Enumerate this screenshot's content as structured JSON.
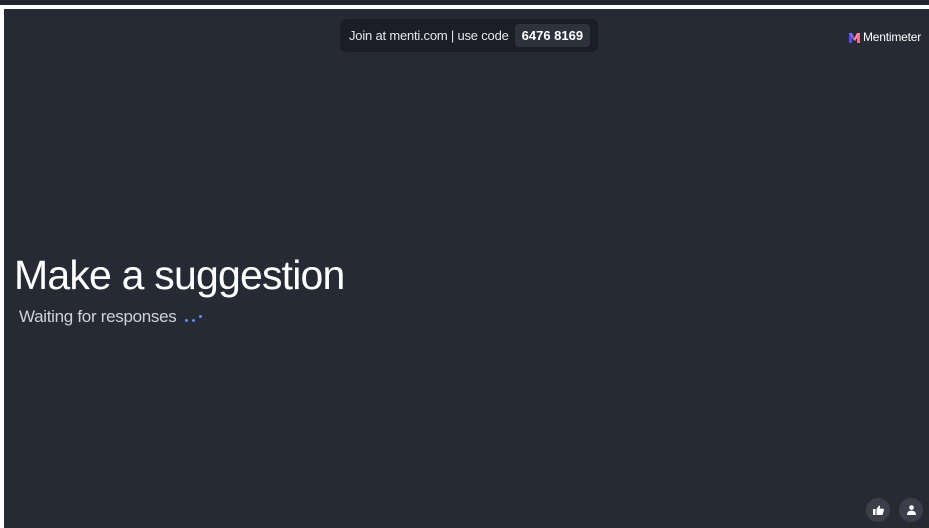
{
  "join_bar": {
    "text": "Join at menti.com | use code",
    "code": "6476 8169"
  },
  "brand": {
    "name": "Mentimeter",
    "icon": "mentimeter-logo-icon",
    "logo_colors": [
      "#5b4bde",
      "#ff6a8b"
    ]
  },
  "slide": {
    "title": "Make a suggestion",
    "status": "Waiting for responses",
    "background": "#262a35",
    "accent": "#5b8def"
  },
  "controls": {
    "reactions_icon": "thumbs-up-icon",
    "participants_icon": "person-icon"
  }
}
